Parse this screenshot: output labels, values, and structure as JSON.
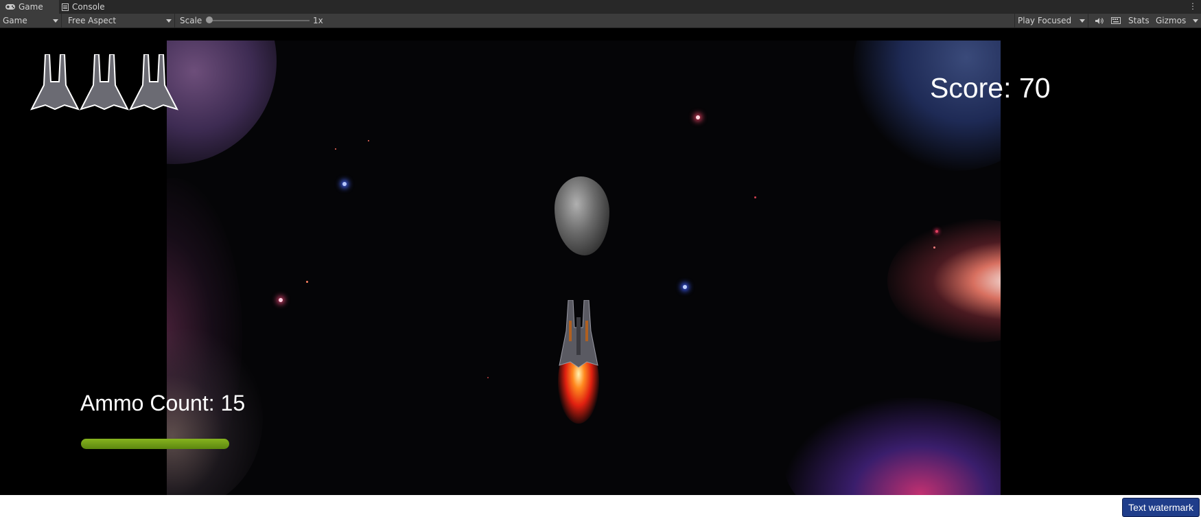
{
  "tabs": [
    {
      "label": "Game",
      "icon": "gamepad-icon",
      "active": true
    },
    {
      "label": "Console",
      "icon": "console-icon",
      "active": false
    }
  ],
  "toolbar": {
    "display": "Game",
    "aspect": "Free Aspect",
    "scale_label": "Scale",
    "scale_value": "1x",
    "play_mode": "Play Focused",
    "stats": "Stats",
    "gizmos": "Gizmos"
  },
  "game": {
    "score_text": "Score: 70",
    "ammo_text": "Ammo Count: 15",
    "ammo_fill": 1.0,
    "lives": 3,
    "colors": {
      "ammo_bar": "#78a81a",
      "hud_text": "#ffffff",
      "background": "#000000"
    }
  },
  "watermark": "Text watermark"
}
